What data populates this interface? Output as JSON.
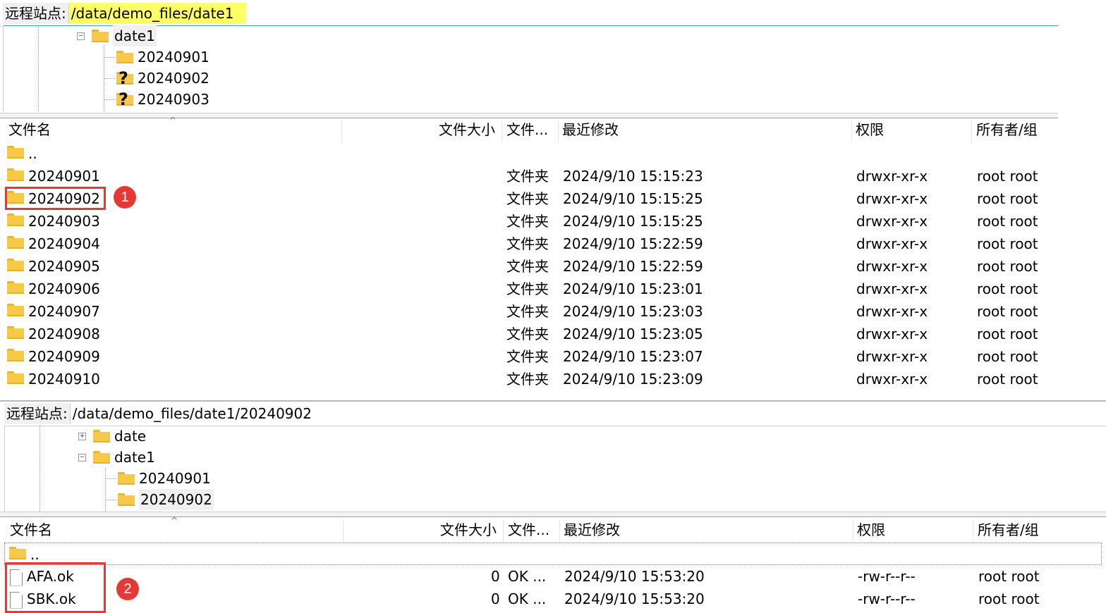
{
  "top_panel": {
    "path_label": "远程站点:",
    "path_value": "/data/demo_files/date1",
    "tree": [
      {
        "label": "date1",
        "expander": "−"
      },
      {
        "label": "20240901"
      },
      {
        "label": "20240902",
        "unknown": true
      },
      {
        "label": "20240903",
        "unknown": true
      }
    ],
    "columns": {
      "name": "文件名",
      "size": "文件大小",
      "type": "文件...",
      "modified": "最近修改",
      "perm": "权限",
      "owner": "所有者/组"
    },
    "rows": [
      {
        "name": "..",
        "type": "",
        "modified": "",
        "perm": "",
        "owner": ""
      },
      {
        "name": "20240901",
        "type": "文件夹",
        "modified": "2024/9/10 15:15:23",
        "perm": "drwxr-xr-x",
        "owner": "root root"
      },
      {
        "name": "20240902",
        "type": "文件夹",
        "modified": "2024/9/10 15:15:25",
        "perm": "drwxr-xr-x",
        "owner": "root root"
      },
      {
        "name": "20240903",
        "type": "文件夹",
        "modified": "2024/9/10 15:15:25",
        "perm": "drwxr-xr-x",
        "owner": "root root"
      },
      {
        "name": "20240904",
        "type": "文件夹",
        "modified": "2024/9/10 15:22:59",
        "perm": "drwxr-xr-x",
        "owner": "root root"
      },
      {
        "name": "20240905",
        "type": "文件夹",
        "modified": "2024/9/10 15:22:59",
        "perm": "drwxr-xr-x",
        "owner": "root root"
      },
      {
        "name": "20240906",
        "type": "文件夹",
        "modified": "2024/9/10 15:23:01",
        "perm": "drwxr-xr-x",
        "owner": "root root"
      },
      {
        "name": "20240907",
        "type": "文件夹",
        "modified": "2024/9/10 15:23:03",
        "perm": "drwxr-xr-x",
        "owner": "root root"
      },
      {
        "name": "20240908",
        "type": "文件夹",
        "modified": "2024/9/10 15:23:05",
        "perm": "drwxr-xr-x",
        "owner": "root root"
      },
      {
        "name": "20240909",
        "type": "文件夹",
        "modified": "2024/9/10 15:23:07",
        "perm": "drwxr-xr-x",
        "owner": "root root"
      },
      {
        "name": "20240910",
        "type": "文件夹",
        "modified": "2024/9/10 15:23:09",
        "perm": "drwxr-xr-x",
        "owner": "root root"
      }
    ],
    "badge": "1"
  },
  "bottom_panel": {
    "path_label": "远程站点:",
    "path_value": "/data/demo_files/date1/20240902",
    "tree": [
      {
        "label": "date",
        "expander": "+"
      },
      {
        "label": "date1",
        "expander": "−"
      },
      {
        "label": "20240901"
      },
      {
        "label": "20240902",
        "selected": true
      }
    ],
    "columns": {
      "name": "文件名",
      "size": "文件大小",
      "type": "文件...",
      "modified": "最近修改",
      "perm": "权限",
      "owner": "所有者/组"
    },
    "rows": [
      {
        "name": "..",
        "size": "",
        "type": "",
        "modified": "",
        "perm": "",
        "owner": ""
      },
      {
        "name": "AFA.ok",
        "size": "0",
        "type": "OK ...",
        "modified": "2024/9/10 15:53:20",
        "perm": "-rw-r--r--",
        "owner": "root root"
      },
      {
        "name": "SBK.ok",
        "size": "0",
        "type": "OK ...",
        "modified": "2024/9/10 15:53:20",
        "perm": "-rw-r--r--",
        "owner": "root root"
      }
    ],
    "badge": "2"
  },
  "colors": {
    "highlight": "#ffff66",
    "annotation_red": "#e53935",
    "folder": "#f7c948"
  }
}
